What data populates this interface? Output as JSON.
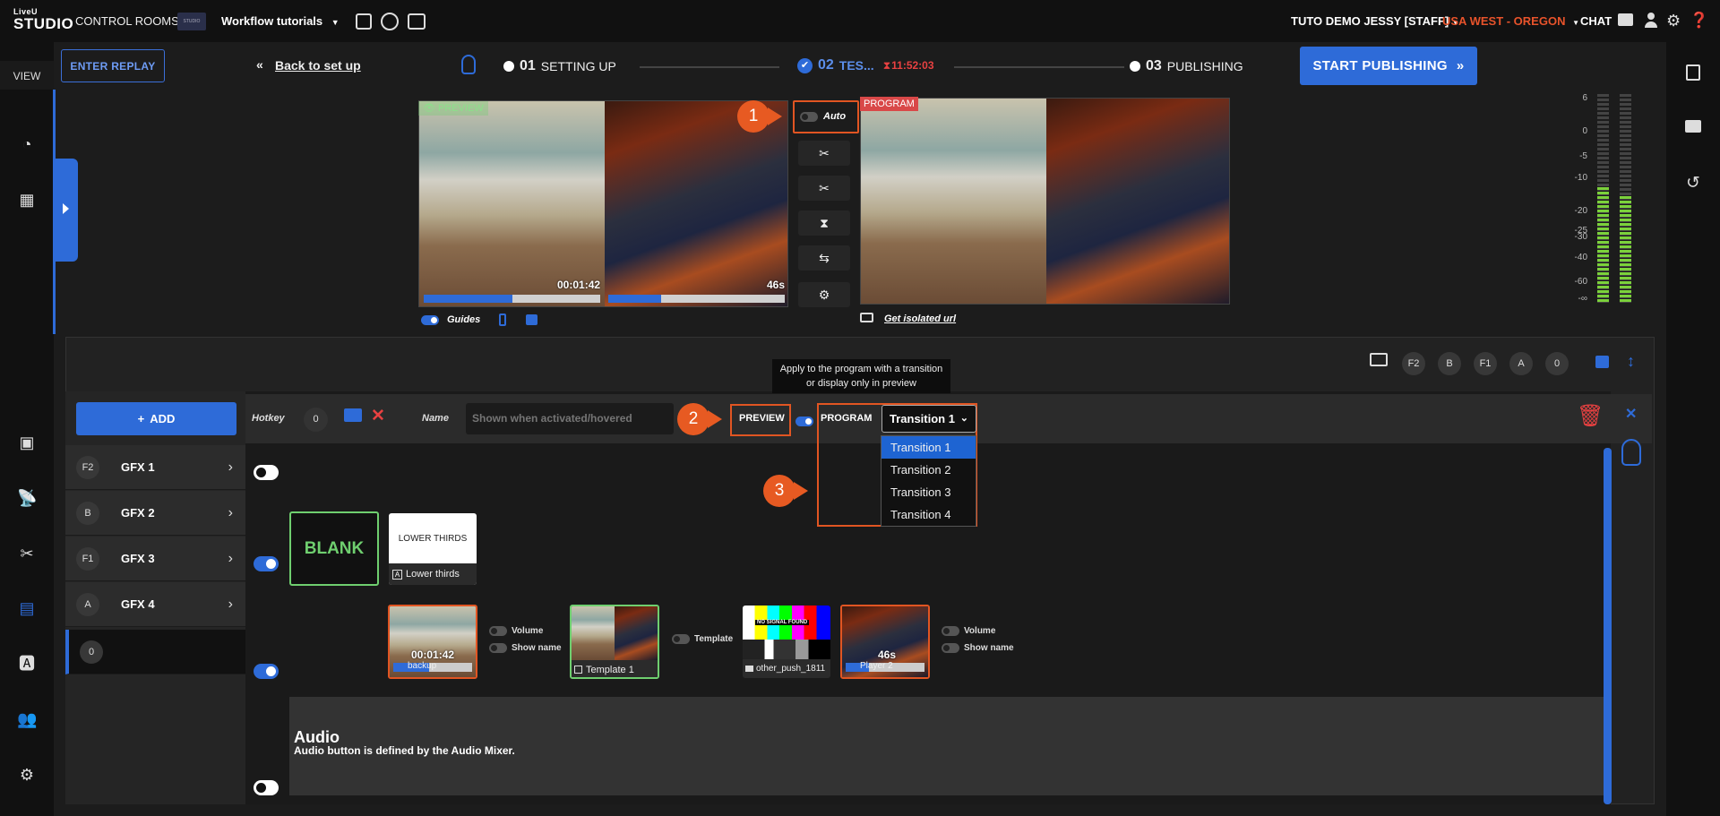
{
  "topbar": {
    "logo_small": "LiveU",
    "logo_big": "STUDIO",
    "control_rooms": "CONTROL ROOMS",
    "room_thumb_text": "STUDIO",
    "room_name": "Workflow tutorials",
    "user": "TUTO DEMO JESSY [STAFF]",
    "region": "USA WEST - OREGON",
    "chat": "CHAT",
    "region_color": "#e8532b"
  },
  "leftbar": {
    "view_label": "VIEW"
  },
  "header": {
    "replay": "ENTER REPLAY",
    "back": "Back to set up",
    "step1_num": "01",
    "step1_label": "SETTING UP",
    "step2_num": "02",
    "step2_label": "TES...",
    "step2_timer": "11:52:03",
    "step3_num": "03",
    "step3_label": "PUBLISHING",
    "start": "START PUBLISHING"
  },
  "monitors": {
    "preview_label": "PREVIEW",
    "program_label": "PROGRAM",
    "preview_timer": "00:01:42",
    "preview_right_timer": "46s",
    "preview_progress_left": 0.5,
    "preview_progress_right": 0.3,
    "auto_label": "Auto",
    "guides": "Guides",
    "isolated_url": "Get isolated url"
  },
  "callouts": [
    "1",
    "2",
    "3"
  ],
  "vu_scale": [
    "6",
    "0",
    "-5",
    "-10",
    "-20",
    "-25",
    "-30",
    "-40",
    "-60",
    "-∞"
  ],
  "panel": {
    "hotkeys": [
      "F2",
      "B",
      "F1",
      "A",
      "0"
    ],
    "add": "ADD",
    "hotkey_label": "Hotkey",
    "hotkey_value": "0",
    "name_label": "Name",
    "name_placeholder": "Shown when activated/hovered",
    "preview": "PREVIEW",
    "program": "PROGRAM",
    "tooltip_line1": "Apply to the program with a transition",
    "tooltip_line2": "or display only in preview",
    "transition_selected": "Transition 1",
    "transitions": [
      "Transition 1",
      "Transition 2",
      "Transition 3",
      "Transition 4"
    ],
    "gfx": [
      {
        "key": "F2",
        "name": "GFX 1"
      },
      {
        "key": "B",
        "name": "GFX 2"
      },
      {
        "key": "F1",
        "name": "GFX 3"
      },
      {
        "key": "A",
        "name": "GFX 4"
      },
      {
        "key": "0",
        "name": ""
      }
    ],
    "blank": "BLANK",
    "lower_thirds_thumb": "LOWER THIRDS",
    "lower_thirds": "Lower thirds",
    "beach_timer": "00:01:42",
    "beach_caption": "backup",
    "volume": "Volume",
    "show_name": "Show name",
    "template1": "Template 1",
    "template": "Template",
    "no_signal": "NO SIGNAL FOUND",
    "other_push": "other_push_1811",
    "player_timer": "46s",
    "player_caption": "Player 2",
    "audio_title": "Audio",
    "audio_desc": "Audio button is defined by the Audio Mixer."
  }
}
